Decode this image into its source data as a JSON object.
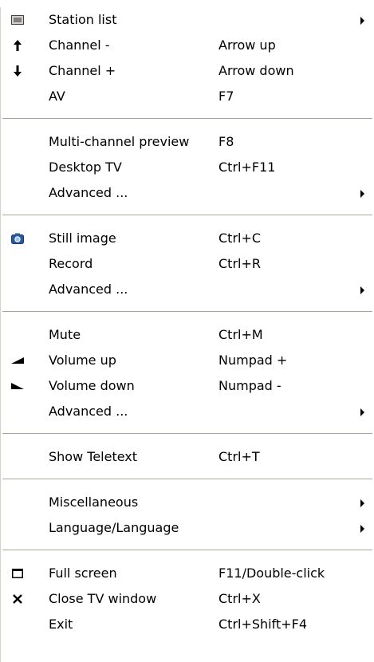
{
  "menu": {
    "items": [
      {
        "label": "Station list",
        "shortcut": "",
        "icon": "station-list-icon"
      },
      {
        "label": "Channel -",
        "shortcut": "Arrow up",
        "icon": "arrow-up-icon"
      },
      {
        "label": "Channel +",
        "shortcut": "Arrow down",
        "icon": "arrow-down-icon"
      },
      {
        "label": "AV",
        "shortcut": "F7"
      },
      {
        "label": "Multi-channel preview",
        "shortcut": "F8"
      },
      {
        "label": "Desktop TV",
        "shortcut": "Ctrl+F11"
      },
      {
        "label": "Advanced ...",
        "shortcut": ""
      },
      {
        "label": "Still image",
        "shortcut": "Ctrl+C",
        "icon": "camera-icon"
      },
      {
        "label": "Record",
        "shortcut": "Ctrl+R"
      },
      {
        "label": "Advanced ...",
        "shortcut": ""
      },
      {
        "label": "Mute",
        "shortcut": "Ctrl+M"
      },
      {
        "label": "Volume up",
        "shortcut": "Numpad +",
        "icon": "volume-up-icon"
      },
      {
        "label": "Volume down",
        "shortcut": "Numpad -",
        "icon": "volume-down-icon"
      },
      {
        "label": "Advanced ...",
        "shortcut": ""
      },
      {
        "label": "Show Teletext",
        "shortcut": "Ctrl+T"
      },
      {
        "label": "Miscellaneous",
        "shortcut": ""
      },
      {
        "label": "Language/Language",
        "shortcut": ""
      },
      {
        "label": "Full screen",
        "shortcut": "F11/Double-click",
        "icon": "fullscreen-icon"
      },
      {
        "label": "Close TV window",
        "shortcut": "Ctrl+X",
        "icon": "close-icon"
      },
      {
        "label": "Exit",
        "shortcut": "Ctrl+Shift+F4"
      }
    ]
  },
  "colors": {
    "separator": "#aca899",
    "camera": "#2a5a9e"
  }
}
